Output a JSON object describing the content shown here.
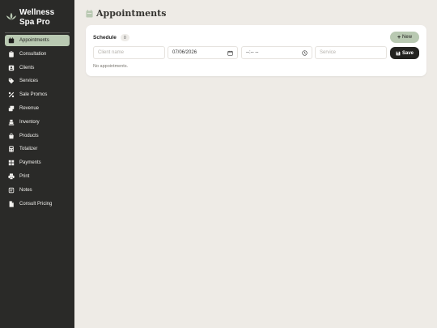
{
  "brand": {
    "title": "Wellness Spa Pro",
    "icon": "lotus-icon"
  },
  "sidebar": {
    "items": [
      {
        "label": "Appointments",
        "icon": "calendar-icon",
        "active": true
      },
      {
        "label": "Consultation",
        "icon": "clipboard-icon",
        "active": false
      },
      {
        "label": "Clients",
        "icon": "contact-card-icon",
        "active": false
      },
      {
        "label": "Services",
        "icon": "tag-icon",
        "active": false
      },
      {
        "label": "Sale Promos",
        "icon": "percent-icon",
        "active": false
      },
      {
        "label": "Revenue",
        "icon": "money-icon",
        "active": false
      },
      {
        "label": "Inventory",
        "icon": "dolly-icon",
        "active": false
      },
      {
        "label": "Products",
        "icon": "shopping-bag-icon",
        "active": false
      },
      {
        "label": "Totalizer",
        "icon": "calculator-icon",
        "active": false
      },
      {
        "label": "Payments",
        "icon": "grid-icon",
        "active": false
      },
      {
        "label": "Print",
        "icon": "printer-icon",
        "active": false
      },
      {
        "label": "Notes",
        "icon": "note-icon",
        "active": false
      },
      {
        "label": "Consult Pricing",
        "icon": "file-icon",
        "active": false
      }
    ]
  },
  "main": {
    "title": "Appointments",
    "title_icon": "calendar-icon"
  },
  "schedule": {
    "title": "Schedule",
    "count": "0",
    "new_label": "New",
    "client_placeholder": "Client name",
    "date_value": "07/06/2026",
    "time_value": "--:-- --",
    "service_placeholder": "Service",
    "save_label": "Save",
    "empty_text": "No appointments."
  },
  "colors": {
    "accent": "#b9c9b2",
    "sidebar_bg": "#2a2a28",
    "page_bg": "#eeebe6",
    "dark_button": "#22221f"
  }
}
